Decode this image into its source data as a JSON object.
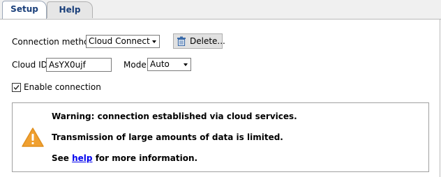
{
  "tabs": [
    {
      "label": "Setup",
      "active": true
    },
    {
      "label": "Help",
      "active": false
    }
  ],
  "connection": {
    "method_label": "Connection method:",
    "method_value": "Cloud Connect",
    "delete_label": "Delete..."
  },
  "cloud": {
    "id_label": "Cloud ID:",
    "id_value": "AsYX0ujf",
    "mode_label": "Mode:",
    "mode_value": "Auto"
  },
  "enable": {
    "label": "Enable connection",
    "checked": true
  },
  "warning": {
    "line1": "Warning: connection established via cloud services.",
    "line2": "Transmission of large amounts of data is limited.",
    "line3_pre": "See",
    "line3_link": "help",
    "line3_post": "for more information."
  },
  "colors": {
    "tab_text": "#1a3f7a",
    "warning_icon": "#f0a030",
    "link": "#0000ee"
  }
}
